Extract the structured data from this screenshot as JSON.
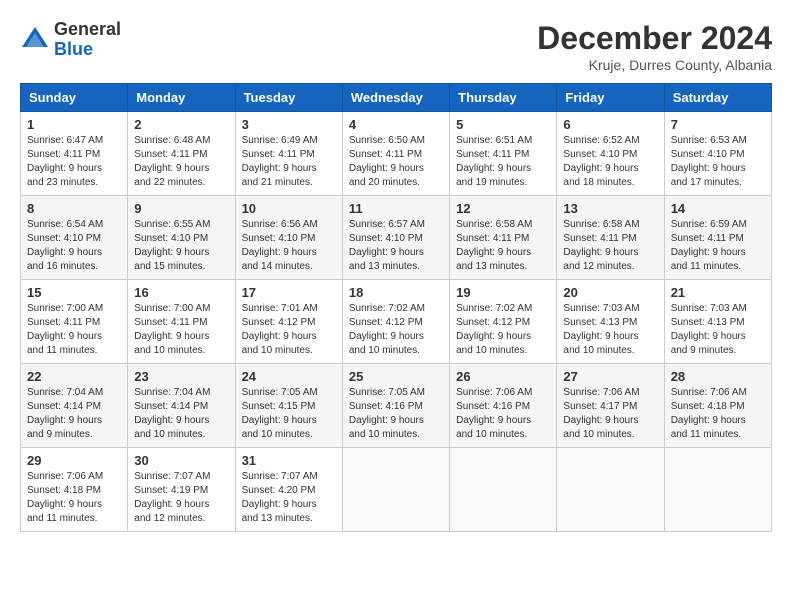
{
  "header": {
    "logo_general": "General",
    "logo_blue": "Blue",
    "month_title": "December 2024",
    "location": "Kruje, Durres County, Albania"
  },
  "weekdays": [
    "Sunday",
    "Monday",
    "Tuesday",
    "Wednesday",
    "Thursday",
    "Friday",
    "Saturday"
  ],
  "weeks": [
    [
      {
        "day": "1",
        "sunrise": "6:47 AM",
        "sunset": "4:11 PM",
        "daylight": "9 hours and 23 minutes."
      },
      {
        "day": "2",
        "sunrise": "6:48 AM",
        "sunset": "4:11 PM",
        "daylight": "9 hours and 22 minutes."
      },
      {
        "day": "3",
        "sunrise": "6:49 AM",
        "sunset": "4:11 PM",
        "daylight": "9 hours and 21 minutes."
      },
      {
        "day": "4",
        "sunrise": "6:50 AM",
        "sunset": "4:11 PM",
        "daylight": "9 hours and 20 minutes."
      },
      {
        "day": "5",
        "sunrise": "6:51 AM",
        "sunset": "4:11 PM",
        "daylight": "9 hours and 19 minutes."
      },
      {
        "day": "6",
        "sunrise": "6:52 AM",
        "sunset": "4:10 PM",
        "daylight": "9 hours and 18 minutes."
      },
      {
        "day": "7",
        "sunrise": "6:53 AM",
        "sunset": "4:10 PM",
        "daylight": "9 hours and 17 minutes."
      }
    ],
    [
      {
        "day": "8",
        "sunrise": "6:54 AM",
        "sunset": "4:10 PM",
        "daylight": "9 hours and 16 minutes."
      },
      {
        "day": "9",
        "sunrise": "6:55 AM",
        "sunset": "4:10 PM",
        "daylight": "9 hours and 15 minutes."
      },
      {
        "day": "10",
        "sunrise": "6:56 AM",
        "sunset": "4:10 PM",
        "daylight": "9 hours and 14 minutes."
      },
      {
        "day": "11",
        "sunrise": "6:57 AM",
        "sunset": "4:10 PM",
        "daylight": "9 hours and 13 minutes."
      },
      {
        "day": "12",
        "sunrise": "6:58 AM",
        "sunset": "4:11 PM",
        "daylight": "9 hours and 13 minutes."
      },
      {
        "day": "13",
        "sunrise": "6:58 AM",
        "sunset": "4:11 PM",
        "daylight": "9 hours and 12 minutes."
      },
      {
        "day": "14",
        "sunrise": "6:59 AM",
        "sunset": "4:11 PM",
        "daylight": "9 hours and 11 minutes."
      }
    ],
    [
      {
        "day": "15",
        "sunrise": "7:00 AM",
        "sunset": "4:11 PM",
        "daylight": "9 hours and 11 minutes."
      },
      {
        "day": "16",
        "sunrise": "7:00 AM",
        "sunset": "4:11 PM",
        "daylight": "9 hours and 10 minutes."
      },
      {
        "day": "17",
        "sunrise": "7:01 AM",
        "sunset": "4:12 PM",
        "daylight": "9 hours and 10 minutes."
      },
      {
        "day": "18",
        "sunrise": "7:02 AM",
        "sunset": "4:12 PM",
        "daylight": "9 hours and 10 minutes."
      },
      {
        "day": "19",
        "sunrise": "7:02 AM",
        "sunset": "4:12 PM",
        "daylight": "9 hours and 10 minutes."
      },
      {
        "day": "20",
        "sunrise": "7:03 AM",
        "sunset": "4:13 PM",
        "daylight": "9 hours and 10 minutes."
      },
      {
        "day": "21",
        "sunrise": "7:03 AM",
        "sunset": "4:13 PM",
        "daylight": "9 hours and 9 minutes."
      }
    ],
    [
      {
        "day": "22",
        "sunrise": "7:04 AM",
        "sunset": "4:14 PM",
        "daylight": "9 hours and 9 minutes."
      },
      {
        "day": "23",
        "sunrise": "7:04 AM",
        "sunset": "4:14 PM",
        "daylight": "9 hours and 10 minutes."
      },
      {
        "day": "24",
        "sunrise": "7:05 AM",
        "sunset": "4:15 PM",
        "daylight": "9 hours and 10 minutes."
      },
      {
        "day": "25",
        "sunrise": "7:05 AM",
        "sunset": "4:16 PM",
        "daylight": "9 hours and 10 minutes."
      },
      {
        "day": "26",
        "sunrise": "7:06 AM",
        "sunset": "4:16 PM",
        "daylight": "9 hours and 10 minutes."
      },
      {
        "day": "27",
        "sunrise": "7:06 AM",
        "sunset": "4:17 PM",
        "daylight": "9 hours and 10 minutes."
      },
      {
        "day": "28",
        "sunrise": "7:06 AM",
        "sunset": "4:18 PM",
        "daylight": "9 hours and 11 minutes."
      }
    ],
    [
      {
        "day": "29",
        "sunrise": "7:06 AM",
        "sunset": "4:18 PM",
        "daylight": "9 hours and 11 minutes."
      },
      {
        "day": "30",
        "sunrise": "7:07 AM",
        "sunset": "4:19 PM",
        "daylight": "9 hours and 12 minutes."
      },
      {
        "day": "31",
        "sunrise": "7:07 AM",
        "sunset": "4:20 PM",
        "daylight": "9 hours and 13 minutes."
      },
      null,
      null,
      null,
      null
    ]
  ]
}
